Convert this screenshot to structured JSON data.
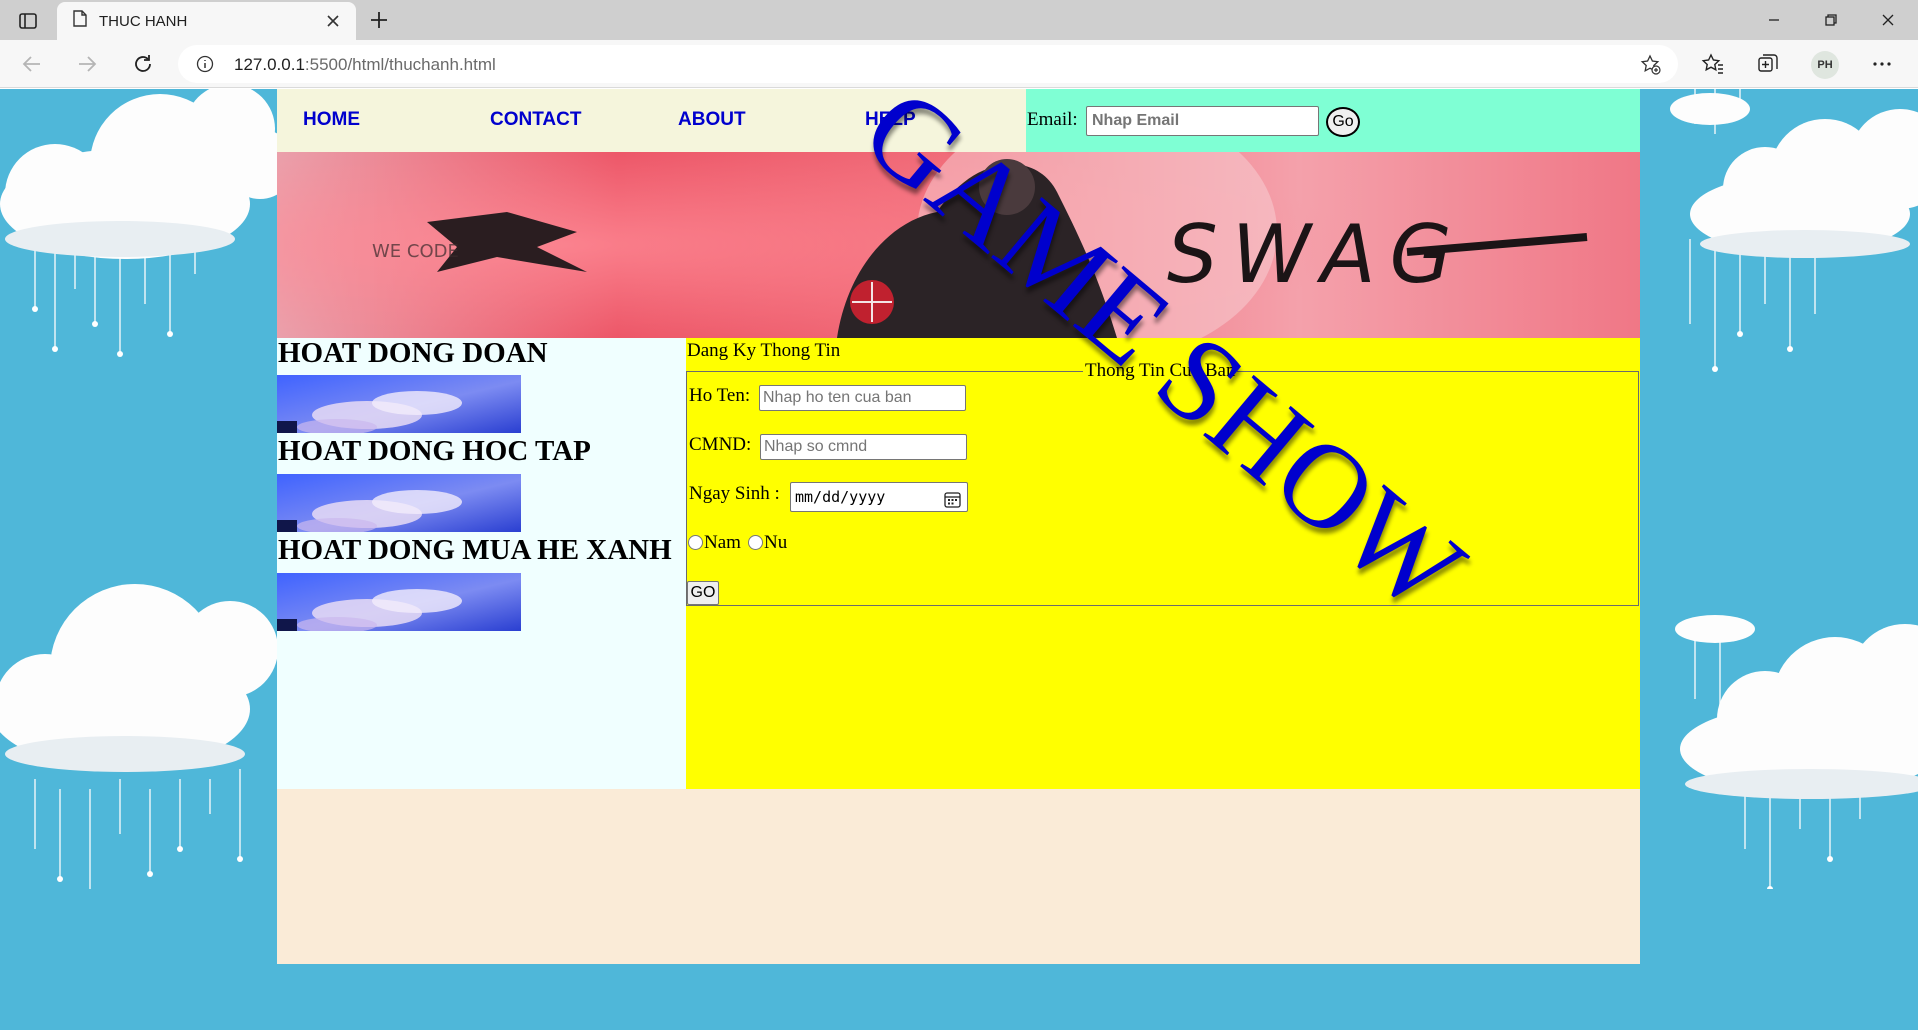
{
  "browser": {
    "tab_title": "THUC HANH",
    "url_host": "127.0.0.1",
    "url_rest": ":5500/html/thuchanh.html",
    "profile_initials": "PH"
  },
  "nav": {
    "items": [
      {
        "label": "HOME"
      },
      {
        "label": "CONTACT"
      },
      {
        "label": "ABOUT"
      },
      {
        "label": "HELP"
      }
    ],
    "email_label": "Email:",
    "email_placeholder": "Nhap Email",
    "email_go": "Go"
  },
  "banner": {
    "overlay_text": "GAME SHOW",
    "image_text_main": "SWAG",
    "image_text_small": "WE CODE"
  },
  "sidebar": {
    "sections": [
      {
        "title": "HOAT DONG DOAN"
      },
      {
        "title": "HOAT DONG HOC TAP"
      },
      {
        "title": "HOAT DONG MUA HE XANH"
      }
    ]
  },
  "form": {
    "heading": "Dang Ky Thong Tin",
    "legend": "Thong Tin Cua Ban",
    "name_label": "Ho Ten:",
    "name_placeholder": "Nhap ho ten cua ban",
    "id_label": "CMND:",
    "id_placeholder": "Nhap so cmnd",
    "dob_label": "Ngay Sinh :",
    "dob_placeholder": "mm/dd/yyyy",
    "gender_male": "Nam",
    "gender_female": "Nu",
    "submit_label": "GO"
  },
  "colors": {
    "page_bg": "#4fb7d9",
    "nav_bg": "#f5f5dc",
    "email_bg": "#7fffd4",
    "sidebar_bg": "#f0ffff",
    "form_bg": "#ffff00",
    "footer_bg": "#faebd7",
    "link": "#0000cd"
  }
}
